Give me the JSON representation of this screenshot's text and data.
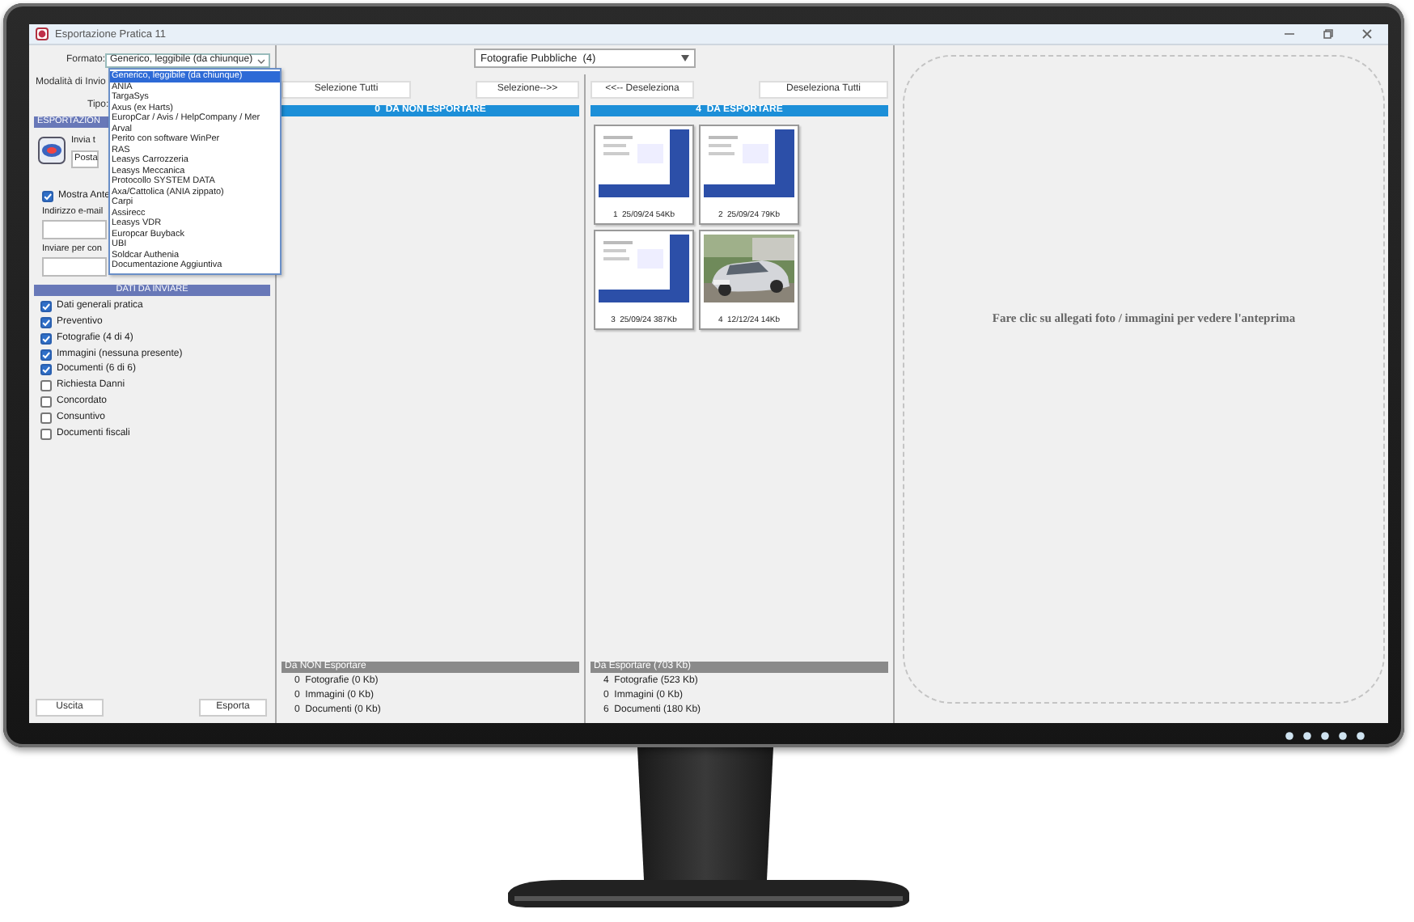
{
  "window": {
    "title": "Esportazione Pratica 11"
  },
  "settings": {
    "format": {
      "label": "Formato:",
      "value": "Generico, leggibile (da chiunque)",
      "expanded": true,
      "options": [
        {
          "label": "Generico, leggibile (da chiunque)",
          "selected": true
        },
        {
          "label": "ANIA",
          "selected": false
        },
        {
          "label": "TargaSys",
          "selected": false
        },
        {
          "label": "Axus (ex Harts)",
          "selected": false
        },
        {
          "label": "EuropCar / Avis / HelpCompany / Mer",
          "selected": false
        },
        {
          "label": "Arval",
          "selected": false
        },
        {
          "label": "Perito con software WinPer",
          "selected": false
        },
        {
          "label": "RAS",
          "selected": false
        },
        {
          "label": "Leasys Carrozzeria",
          "selected": false
        },
        {
          "label": "Leasys Meccanica",
          "selected": false
        },
        {
          "label": "Protocollo SYSTEM DATA",
          "selected": false
        },
        {
          "label": "Axa/Cattolica  (ANIA zippato)",
          "selected": false
        },
        {
          "label": "Carpi",
          "selected": false
        },
        {
          "label": "Assirecc",
          "selected": false
        },
        {
          "label": "Leasys VDR",
          "selected": false
        },
        {
          "label": "Europcar Buyback",
          "selected": false
        },
        {
          "label": "UBI",
          "selected": false
        },
        {
          "label": "Soldcar Authenia",
          "selected": false
        },
        {
          "label": "Documentazione Aggiuntiva",
          "selected": false
        }
      ]
    },
    "send_mode": {
      "label": "Modalità di Invio"
    },
    "type": {
      "label": "Tipo:"
    },
    "export_section": {
      "title": "ESPORTAZION",
      "send_label": "Invia t",
      "send_value": "Posta"
    },
    "show_preview": {
      "label": "Mostra Ante",
      "checked": true
    },
    "email": {
      "label": "Indirizzo e-mail"
    },
    "send_cc": {
      "label": "Inviare per con"
    },
    "data_section": {
      "title": "DATI DA INVIARE",
      "items": [
        {
          "label": "Dati generali pratica",
          "checked": true
        },
        {
          "label": "Preventivo",
          "checked": true
        },
        {
          "label": "Fotografie  (4 di 4)",
          "checked": true
        },
        {
          "label": "Immagini  (nessuna presente)",
          "checked": true
        },
        {
          "label": "Documenti  (6 di 6)",
          "checked": true
        },
        {
          "label": "Richiesta Danni",
          "checked": false
        },
        {
          "label": "Concordato",
          "checked": false
        },
        {
          "label": "Consuntivo",
          "checked": false
        },
        {
          "label": "Documenti fiscali",
          "checked": false
        }
      ]
    },
    "buttons": [
      "Uscita",
      "Esporta"
    ]
  },
  "selection": {
    "filter": "Fotografie Pubbliche  (4)",
    "columns": [
      {
        "buttons": [
          "Selezione Tutti",
          "Selezione-->>"
        ],
        "header": "0  DA NON ESPORTARE",
        "summary_header": "Da NON Esportare",
        "summary": [
          "0  Fotografie (0 Kb)",
          "0  Immagini (0 Kb)",
          "0  Documenti (0 Kb)"
        ]
      },
      {
        "buttons": [
          "<<-- Deseleziona",
          "Deseleziona Tutti"
        ],
        "header": "4  DA ESPORTARE",
        "items": [
          {
            "kind": "screenshot",
            "caption": "1  25/09/24 54Kb"
          },
          {
            "kind": "screenshot",
            "caption": "2  25/09/24 79Kb"
          },
          {
            "kind": "screenshot",
            "caption": "3  25/09/24 387Kb"
          },
          {
            "kind": "picture",
            "caption": "4  12/12/24 14Kb"
          }
        ],
        "summary_header": "Da Esportare (703 Kb)",
        "summary": [
          "4  Fotografie (523 Kb)",
          "0  Immagini (0 Kb)",
          "6  Documenti (180 Kb)"
        ]
      }
    ]
  },
  "preview": {
    "message": "Fare clic su allegati foto / immagini per vedere l'anteprima"
  }
}
